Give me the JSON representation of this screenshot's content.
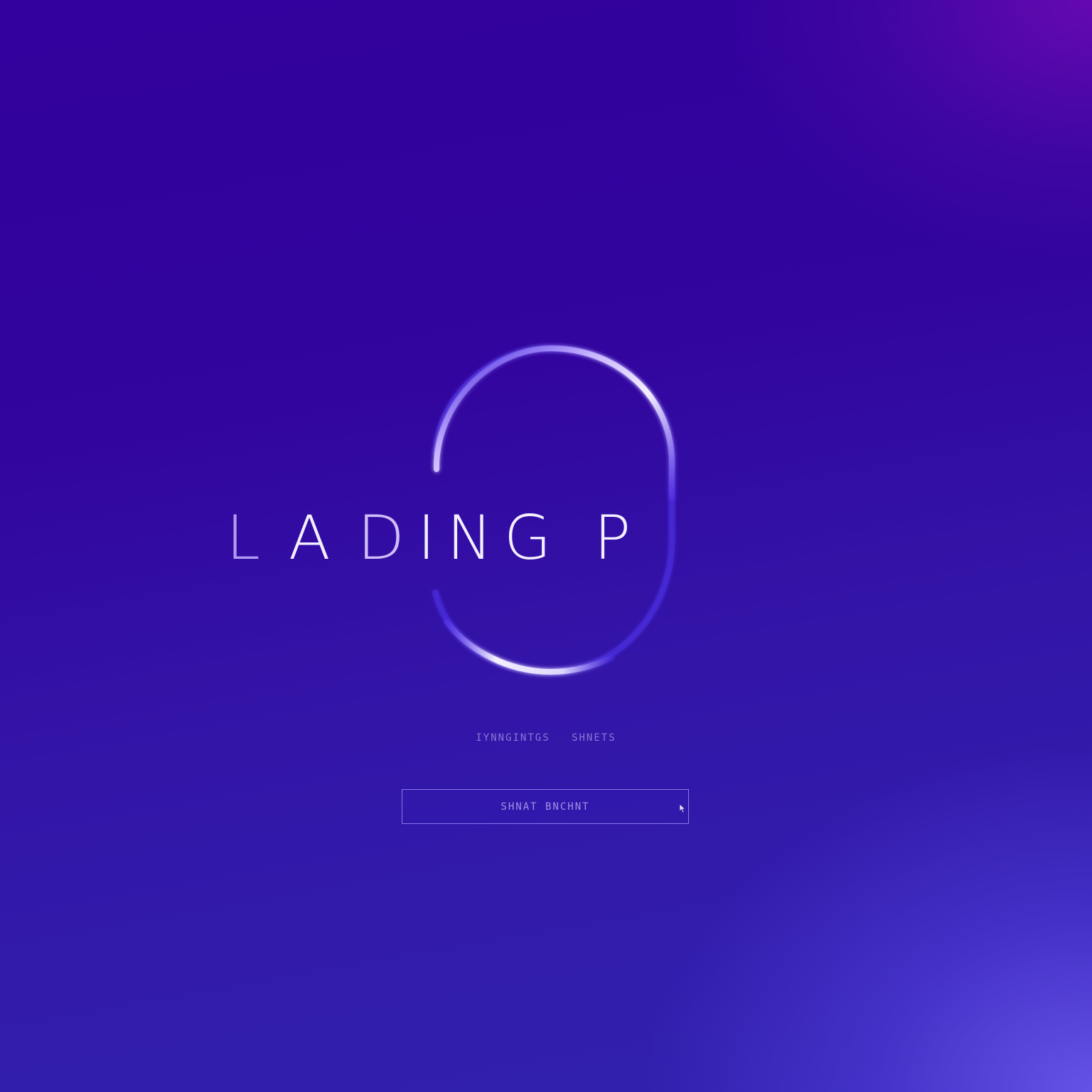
{
  "loading": {
    "title_chars": [
      "L",
      "A",
      "D",
      "I",
      "N",
      "G",
      " ",
      "P"
    ],
    "status_left": "IYNNGINTGS",
    "status_right": "SHNETS"
  },
  "start_button": {
    "label": "SHNAT BNCHNT"
  },
  "icons": {
    "ring": "loading-ring-icon",
    "cursor": "cursor-arrow-icon"
  },
  "colors": {
    "background_top": "#32009c",
    "background_bottom_right": "#6e5af0",
    "ring_highlight": "#f4efff",
    "ring_glow": "#4a2ee0",
    "text": "#f4efff"
  }
}
